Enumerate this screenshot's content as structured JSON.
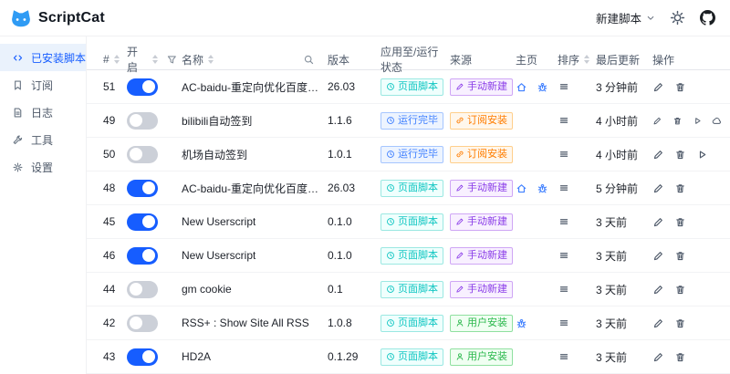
{
  "app": {
    "title": "ScriptCat"
  },
  "topbar": {
    "new_script_label": "新建脚本",
    "icons": [
      "cat-logo",
      "chevron-down-icon",
      "sun-icon",
      "github-icon"
    ]
  },
  "sidebar": {
    "items": [
      {
        "label": "已安装脚本",
        "icon": "code-icon",
        "active": true
      },
      {
        "label": "订阅",
        "icon": "bookmark-icon",
        "active": false
      },
      {
        "label": "日志",
        "icon": "file-icon",
        "active": false
      },
      {
        "label": "工具",
        "icon": "wrench-icon",
        "active": false
      },
      {
        "label": "设置",
        "icon": "gear-icon",
        "active": false
      }
    ]
  },
  "table": {
    "headers": {
      "id": "#",
      "enabled": "开启",
      "name": "名称",
      "version": "版本",
      "status": "应用至/运行状态",
      "source": "来源",
      "homepage": "主页",
      "sort": "排序",
      "updated": "最后更新",
      "actions": "操作"
    },
    "header_icons": {
      "enabled_filter": "filter-icon",
      "name_search": "search-icon",
      "sorters": "caret-sort"
    },
    "badge_icons": {
      "status": "clock-icon",
      "manual": "pencil-icon",
      "subscribe": "link-icon",
      "user": "user-icon"
    },
    "rows": [
      {
        "id": "51",
        "enabled": true,
        "name": "AC-baidu-重定向优化百度搜狗谷歌...",
        "version": "26.03",
        "status": "页面脚本",
        "status_color": "cyan",
        "source": "手动新建",
        "source_color": "purple",
        "homepage_icons": [
          "home-icon",
          "bug-icon"
        ],
        "updated": "3 分钟前",
        "actions": [
          "edit-icon",
          "trash-icon"
        ]
      },
      {
        "id": "49",
        "enabled": false,
        "name": "bilibili自动签到",
        "version": "1.1.6",
        "status": "运行完毕",
        "status_color": "blue",
        "source": "订阅安装",
        "source_color": "orange",
        "homepage_icons": [],
        "updated": "4 小时前",
        "actions": [
          "edit-icon",
          "trash-icon",
          "play-icon",
          "cloud-icon"
        ]
      },
      {
        "id": "50",
        "enabled": false,
        "name": "机场自动签到",
        "version": "1.0.1",
        "status": "运行完毕",
        "status_color": "blue",
        "source": "订阅安装",
        "source_color": "orange",
        "homepage_icons": [],
        "updated": "4 小时前",
        "actions": [
          "edit-icon",
          "trash-icon",
          "play-icon"
        ]
      },
      {
        "id": "48",
        "enabled": true,
        "name": "AC-baidu-重定向优化百度搜狗谷歌...",
        "version": "26.03",
        "status": "页面脚本",
        "status_color": "cyan",
        "source": "手动新建",
        "source_color": "purple",
        "homepage_icons": [
          "home-icon",
          "bug-icon"
        ],
        "updated": "5 分钟前",
        "actions": [
          "edit-icon",
          "trash-icon"
        ]
      },
      {
        "id": "45",
        "enabled": true,
        "name": "New Userscript",
        "version": "0.1.0",
        "status": "页面脚本",
        "status_color": "cyan",
        "source": "手动新建",
        "source_color": "purple",
        "homepage_icons": [],
        "updated": "3 天前",
        "actions": [
          "edit-icon",
          "trash-icon"
        ]
      },
      {
        "id": "46",
        "enabled": true,
        "name": "New Userscript",
        "version": "0.1.0",
        "status": "页面脚本",
        "status_color": "cyan",
        "source": "手动新建",
        "source_color": "purple",
        "homepage_icons": [],
        "updated": "3 天前",
        "actions": [
          "edit-icon",
          "trash-icon"
        ]
      },
      {
        "id": "44",
        "enabled": false,
        "name": "gm cookie",
        "version": "0.1",
        "status": "页面脚本",
        "status_color": "cyan",
        "source": "手动新建",
        "source_color": "purple",
        "homepage_icons": [],
        "updated": "3 天前",
        "actions": [
          "edit-icon",
          "trash-icon"
        ]
      },
      {
        "id": "42",
        "enabled": false,
        "name": "RSS+ : Show Site All RSS",
        "version": "1.0.8",
        "status": "页面脚本",
        "status_color": "cyan",
        "source": "用户安装",
        "source_color": "green",
        "homepage_icons": [
          "bug-icon"
        ],
        "updated": "3 天前",
        "actions": [
          "edit-icon",
          "trash-icon"
        ]
      },
      {
        "id": "43",
        "enabled": true,
        "name": "HD2A",
        "version": "0.1.29",
        "status": "页面脚本",
        "status_color": "cyan",
        "source": "用户安装",
        "source_color": "green",
        "homepage_icons": [],
        "updated": "3 天前",
        "actions": [
          "edit-icon",
          "trash-icon"
        ]
      }
    ]
  },
  "colors": {
    "primary": "#165dff",
    "logo_blue": "#2f9bf4",
    "badge_cyan": "#0fc6c2",
    "badge_blue": "#4080ff",
    "badge_purple": "#8a3ce8",
    "badge_orange": "#ff7d00",
    "badge_green": "#2bb84d",
    "sidebar_active_bg": "#eaf2fc"
  }
}
